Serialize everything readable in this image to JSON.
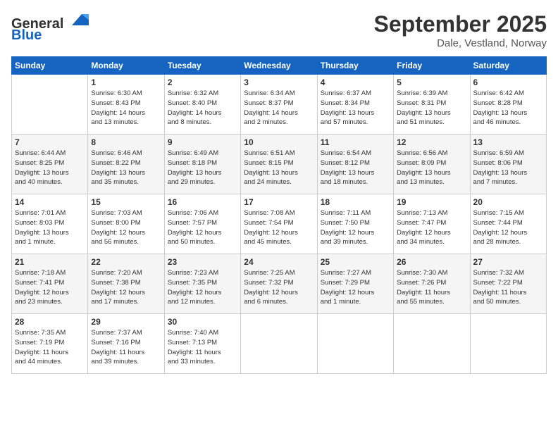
{
  "header": {
    "logo_general": "General",
    "logo_blue": "Blue",
    "month_title": "September 2025",
    "location": "Dale, Vestland, Norway"
  },
  "weekdays": [
    "Sunday",
    "Monday",
    "Tuesday",
    "Wednesday",
    "Thursday",
    "Friday",
    "Saturday"
  ],
  "weeks": [
    [
      {
        "day": "",
        "info": ""
      },
      {
        "day": "1",
        "info": "Sunrise: 6:30 AM\nSunset: 8:43 PM\nDaylight: 14 hours\nand 13 minutes."
      },
      {
        "day": "2",
        "info": "Sunrise: 6:32 AM\nSunset: 8:40 PM\nDaylight: 14 hours\nand 8 minutes."
      },
      {
        "day": "3",
        "info": "Sunrise: 6:34 AM\nSunset: 8:37 PM\nDaylight: 14 hours\nand 2 minutes."
      },
      {
        "day": "4",
        "info": "Sunrise: 6:37 AM\nSunset: 8:34 PM\nDaylight: 13 hours\nand 57 minutes."
      },
      {
        "day": "5",
        "info": "Sunrise: 6:39 AM\nSunset: 8:31 PM\nDaylight: 13 hours\nand 51 minutes."
      },
      {
        "day": "6",
        "info": "Sunrise: 6:42 AM\nSunset: 8:28 PM\nDaylight: 13 hours\nand 46 minutes."
      }
    ],
    [
      {
        "day": "7",
        "info": "Sunrise: 6:44 AM\nSunset: 8:25 PM\nDaylight: 13 hours\nand 40 minutes."
      },
      {
        "day": "8",
        "info": "Sunrise: 6:46 AM\nSunset: 8:22 PM\nDaylight: 13 hours\nand 35 minutes."
      },
      {
        "day": "9",
        "info": "Sunrise: 6:49 AM\nSunset: 8:18 PM\nDaylight: 13 hours\nand 29 minutes."
      },
      {
        "day": "10",
        "info": "Sunrise: 6:51 AM\nSunset: 8:15 PM\nDaylight: 13 hours\nand 24 minutes."
      },
      {
        "day": "11",
        "info": "Sunrise: 6:54 AM\nSunset: 8:12 PM\nDaylight: 13 hours\nand 18 minutes."
      },
      {
        "day": "12",
        "info": "Sunrise: 6:56 AM\nSunset: 8:09 PM\nDaylight: 13 hours\nand 13 minutes."
      },
      {
        "day": "13",
        "info": "Sunrise: 6:59 AM\nSunset: 8:06 PM\nDaylight: 13 hours\nand 7 minutes."
      }
    ],
    [
      {
        "day": "14",
        "info": "Sunrise: 7:01 AM\nSunset: 8:03 PM\nDaylight: 13 hours\nand 1 minute."
      },
      {
        "day": "15",
        "info": "Sunrise: 7:03 AM\nSunset: 8:00 PM\nDaylight: 12 hours\nand 56 minutes."
      },
      {
        "day": "16",
        "info": "Sunrise: 7:06 AM\nSunset: 7:57 PM\nDaylight: 12 hours\nand 50 minutes."
      },
      {
        "day": "17",
        "info": "Sunrise: 7:08 AM\nSunset: 7:54 PM\nDaylight: 12 hours\nand 45 minutes."
      },
      {
        "day": "18",
        "info": "Sunrise: 7:11 AM\nSunset: 7:50 PM\nDaylight: 12 hours\nand 39 minutes."
      },
      {
        "day": "19",
        "info": "Sunrise: 7:13 AM\nSunset: 7:47 PM\nDaylight: 12 hours\nand 34 minutes."
      },
      {
        "day": "20",
        "info": "Sunrise: 7:15 AM\nSunset: 7:44 PM\nDaylight: 12 hours\nand 28 minutes."
      }
    ],
    [
      {
        "day": "21",
        "info": "Sunrise: 7:18 AM\nSunset: 7:41 PM\nDaylight: 12 hours\nand 23 minutes."
      },
      {
        "day": "22",
        "info": "Sunrise: 7:20 AM\nSunset: 7:38 PM\nDaylight: 12 hours\nand 17 minutes."
      },
      {
        "day": "23",
        "info": "Sunrise: 7:23 AM\nSunset: 7:35 PM\nDaylight: 12 hours\nand 12 minutes."
      },
      {
        "day": "24",
        "info": "Sunrise: 7:25 AM\nSunset: 7:32 PM\nDaylight: 12 hours\nand 6 minutes."
      },
      {
        "day": "25",
        "info": "Sunrise: 7:27 AM\nSunset: 7:29 PM\nDaylight: 12 hours\nand 1 minute."
      },
      {
        "day": "26",
        "info": "Sunrise: 7:30 AM\nSunset: 7:26 PM\nDaylight: 11 hours\nand 55 minutes."
      },
      {
        "day": "27",
        "info": "Sunrise: 7:32 AM\nSunset: 7:22 PM\nDaylight: 11 hours\nand 50 minutes."
      }
    ],
    [
      {
        "day": "28",
        "info": "Sunrise: 7:35 AM\nSunset: 7:19 PM\nDaylight: 11 hours\nand 44 minutes."
      },
      {
        "day": "29",
        "info": "Sunrise: 7:37 AM\nSunset: 7:16 PM\nDaylight: 11 hours\nand 39 minutes."
      },
      {
        "day": "30",
        "info": "Sunrise: 7:40 AM\nSunset: 7:13 PM\nDaylight: 11 hours\nand 33 minutes."
      },
      {
        "day": "",
        "info": ""
      },
      {
        "day": "",
        "info": ""
      },
      {
        "day": "",
        "info": ""
      },
      {
        "day": "",
        "info": ""
      }
    ]
  ]
}
